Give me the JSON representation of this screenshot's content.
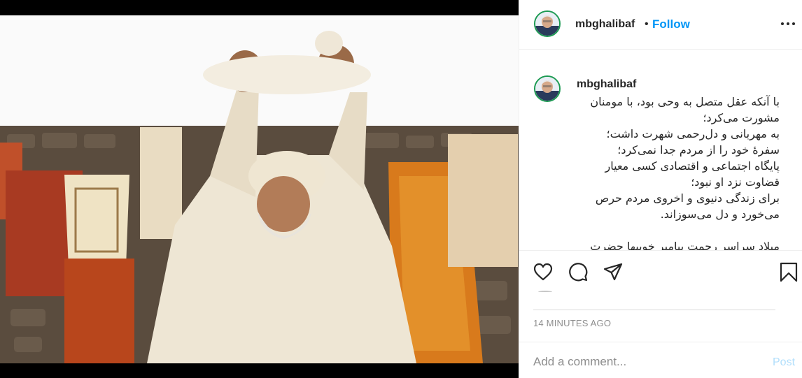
{
  "post": {
    "image_alt_icon": "photo-scene"
  },
  "header": {
    "username": "mbghalibaf",
    "separator": "•",
    "follow_label": "Follow",
    "more_icon": "more-horizontal-icon"
  },
  "caption": {
    "username": "mbghalibaf",
    "lines": [
      "با آنکه عقل متصل به وحی بود، با مومنان",
      "مشورت می‌کرد؛",
      "به مهربانی و دل‌رحمی شهرت داشت؛",
      "سفرهٔ خود را از مردم جدا نمی‌کرد؛",
      "پایگاه اجتماعی و اقتصادی کسی معیار",
      "قضاوت نزد او نبود؛",
      "برای زندگی دنیوی و اخروی مردم حرص",
      "می‌خورد و دل می‌سوزاند.",
      "",
      "میلاد سراسر رحمت پیامبر خوبیها حضرت"
    ]
  },
  "actions": {
    "like_icon": "heart-icon",
    "comment_icon": "comment-icon",
    "share_icon": "send-icon",
    "save_icon": "bookmark-icon"
  },
  "timestamp": "14 MINUTES AGO",
  "comment": {
    "placeholder": "Add a comment...",
    "post_label": "Post"
  },
  "colors": {
    "accent": "#0095f6",
    "post_disabled": "#b2dffc",
    "text": "#262626",
    "muted": "#8e8e8e"
  }
}
